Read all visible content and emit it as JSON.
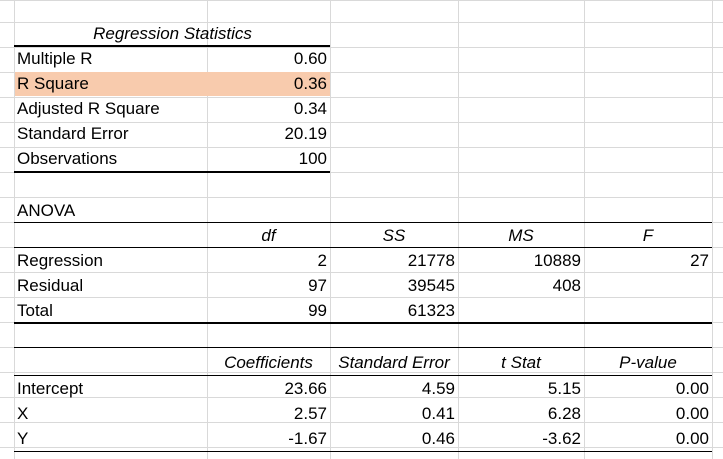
{
  "regression_statistics": {
    "title": "Regression Statistics",
    "rows": [
      {
        "label": "Multiple R",
        "value": "0.60"
      },
      {
        "label": "R Square",
        "value": "0.36"
      },
      {
        "label": "Adjusted R Square",
        "value": "0.34"
      },
      {
        "label": "Standard Error",
        "value": "20.19"
      },
      {
        "label": "Observations",
        "value": "100"
      }
    ],
    "highlight_color": "#f8cbad"
  },
  "anova": {
    "title": "ANOVA",
    "headers": [
      "df",
      "SS",
      "MS",
      "F"
    ],
    "rows": [
      {
        "label": "Regression",
        "df": "2",
        "ss": "21778",
        "ms": "10889",
        "f": "27"
      },
      {
        "label": "Residual",
        "df": "97",
        "ss": "39545",
        "ms": "408",
        "f": ""
      },
      {
        "label": "Total",
        "df": "99",
        "ss": "61323",
        "ms": "",
        "f": ""
      }
    ]
  },
  "coefficients": {
    "headers": [
      "Coefficients",
      "Standard Error",
      "t Stat",
      "P-value"
    ],
    "rows": [
      {
        "label": "Intercept",
        "coef": "23.66",
        "se": "4.59",
        "t": "5.15",
        "p": "0.00"
      },
      {
        "label": "X",
        "coef": "2.57",
        "se": "0.41",
        "t": "6.28",
        "p": "0.00"
      },
      {
        "label": "Y",
        "coef": "-1.67",
        "se": "0.46",
        "t": "-3.62",
        "p": "0.00"
      }
    ]
  }
}
